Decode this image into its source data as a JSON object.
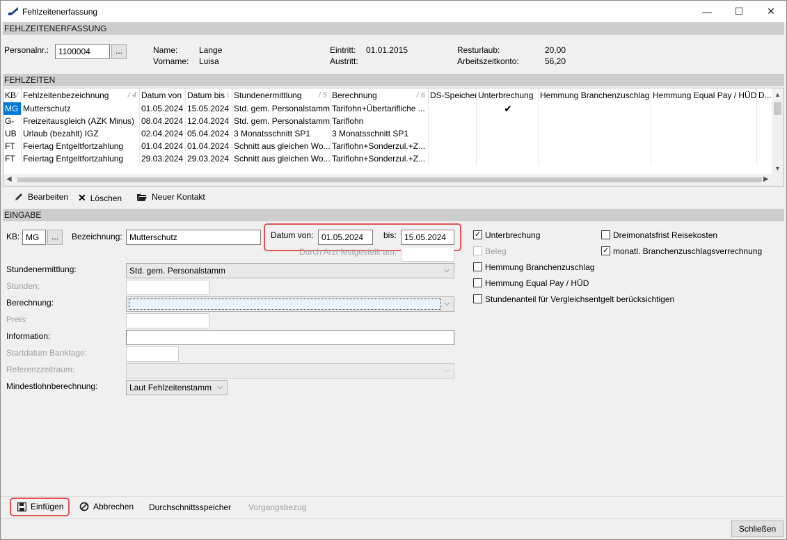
{
  "window": {
    "title": "Fehlzeitenerfassung",
    "minimize_glyph": "—",
    "maximize_glyph": "☐",
    "close_glyph": "✕"
  },
  "header_section": {
    "title": "FEHLZEITENERFASSUNG",
    "personalnr_label": "Personalnr.:",
    "personalnr_value": "1100004",
    "browse_label": "...",
    "name_label": "Name:",
    "name_value": "Lange",
    "vorname_label": "Vorname:",
    "vorname_value": "Luisa",
    "eintritt_label": "Eintritt:",
    "eintritt_value": "01.01.2015",
    "austritt_label": "Austritt:",
    "austritt_value": "",
    "resturlaub_label": "Resturlaub:",
    "resturlaub_value": "20,00",
    "arbeitszeitkonto_label": "Arbeitszeitkonto:",
    "arbeitszeitkonto_value": "56,20"
  },
  "fehlzeiten": {
    "title": "FEHLZEITEN",
    "columns": [
      {
        "label": "KB",
        "sort": "/"
      },
      {
        "label": "Fehlzeitenbezeichnung",
        "sort": "/ 4"
      },
      {
        "label": "Datum von",
        "sort": ""
      },
      {
        "label": "Datum bis",
        "sort": "\\"
      },
      {
        "label": "Stundenermittlung",
        "sort": "/ 5"
      },
      {
        "label": "Berechnung",
        "sort": "/ 6"
      },
      {
        "label": "DS-Speicher",
        "sort": ""
      },
      {
        "label": "Unterbrechung",
        "sort": ""
      },
      {
        "label": "Hemmung Branchenzuschlag",
        "sort": ""
      },
      {
        "label": "Hemmung Equal Pay / HÜD",
        "sort": ""
      },
      {
        "label": "D...",
        "sort": ""
      }
    ],
    "rows": [
      {
        "kb": "MG",
        "bez": "Mutterschutz",
        "von": "01.05.2024",
        "bis": "15.05.2024",
        "stunden": "Std. gem. Personalstamm",
        "berechnung": "Tarifohn+Übertarifliche ...",
        "unterbrechung": "✔"
      },
      {
        "kb": "G-",
        "bez": "Freizeitausgleich (AZK Minus)",
        "von": "08.04.2024",
        "bis": "12.04.2024",
        "stunden": "Std. gem. Personalstamm",
        "berechnung": "Tariflohn",
        "unterbrechung": ""
      },
      {
        "kb": "UB",
        "bez": "Urlaub (bezahlt) IGZ",
        "von": "02.04.2024",
        "bis": "05.04.2024",
        "stunden": "3 Monatsschnitt SP1",
        "berechnung": "3 Monatsschnitt SP1",
        "unterbrechung": ""
      },
      {
        "kb": "FT",
        "bez": "Feiertag Entgeltfortzahlung",
        "von": "01.04.2024",
        "bis": "01.04.2024",
        "stunden": "Schnitt aus gleichen Wo...",
        "berechnung": "Tariflohn+Sonderzul.+Z...",
        "unterbrechung": ""
      },
      {
        "kb": "FT",
        "bez": "Feiertag Entgeltfortzahlung",
        "von": "29.03.2024",
        "bis": "29.03.2024",
        "stunden": "Schnitt aus gleichen Wo...",
        "berechnung": "Tariflohn+Sonderzul.+Z...",
        "unterbrechung": ""
      }
    ]
  },
  "toolbar": {
    "bearbeiten": "Bearbeiten",
    "loeschen": "Löschen",
    "neuer_kontakt": "Neuer Kontakt"
  },
  "eingabe": {
    "title": "EINGABE",
    "kb_label": "KB:",
    "kb_value": "MG",
    "kb_browse": "...",
    "bezeichnung_label": "Bezeichnung:",
    "bezeichnung_value": "Mutterschutz",
    "datum_von_label": "Datum von:",
    "datum_von_value": "01.05.2024",
    "bis_label": "bis:",
    "bis_value": "15.05.2024",
    "arzt_label": "Durch Arzt festgestellt am:",
    "stundenermittlung_label": "Stundenermittlung:",
    "stundenermittlung_value": "Std. gem. Personalstamm",
    "stunden_label": "Stunden:",
    "berechnung_label": "Berechnung:",
    "berechnung_value": "",
    "preis_label": "Preis:",
    "information_label": "Information:",
    "startdatum_label": "Startdatum Banktage:",
    "referenz_label": "Referenzzeitraum:",
    "mindestlohn_label": "Mindestlohnberechnung:",
    "mindestlohn_value": "Laut Fehlzeitenstamm",
    "checkboxes": {
      "unterbrechung": {
        "label": "Unterbrechung",
        "checked": "✓"
      },
      "beleg": {
        "label": "Beleg",
        "checked": ""
      },
      "hemmung_branchen": {
        "label": "Hemmung Branchenzuschlag",
        "checked": ""
      },
      "hemmung_equal": {
        "label": "Hemmung Equal Pay / HÜD",
        "checked": ""
      },
      "stundenanteil": {
        "label": "Stundenanteil für Vergleichsentgelt berücksichtigen",
        "checked": ""
      },
      "dreimonatsfrist": {
        "label": "Dreimonatsfrist Reisekosten",
        "checked": ""
      },
      "monatl": {
        "label": "monatl. Branchenzuschlagsverrechnung",
        "checked": "✓"
      }
    }
  },
  "actions": {
    "einfuegen": "Einfügen",
    "abbrechen": "Abbrechen",
    "durchschnittsspeicher": "Durchschnittsspeicher",
    "vorgangsbezug": "Vorgangsbezug",
    "schliessen": "Schließen"
  },
  "colors": {
    "highlight": "#e05656",
    "selection": "#0078d7",
    "section_bar": "#cdcdcd"
  }
}
